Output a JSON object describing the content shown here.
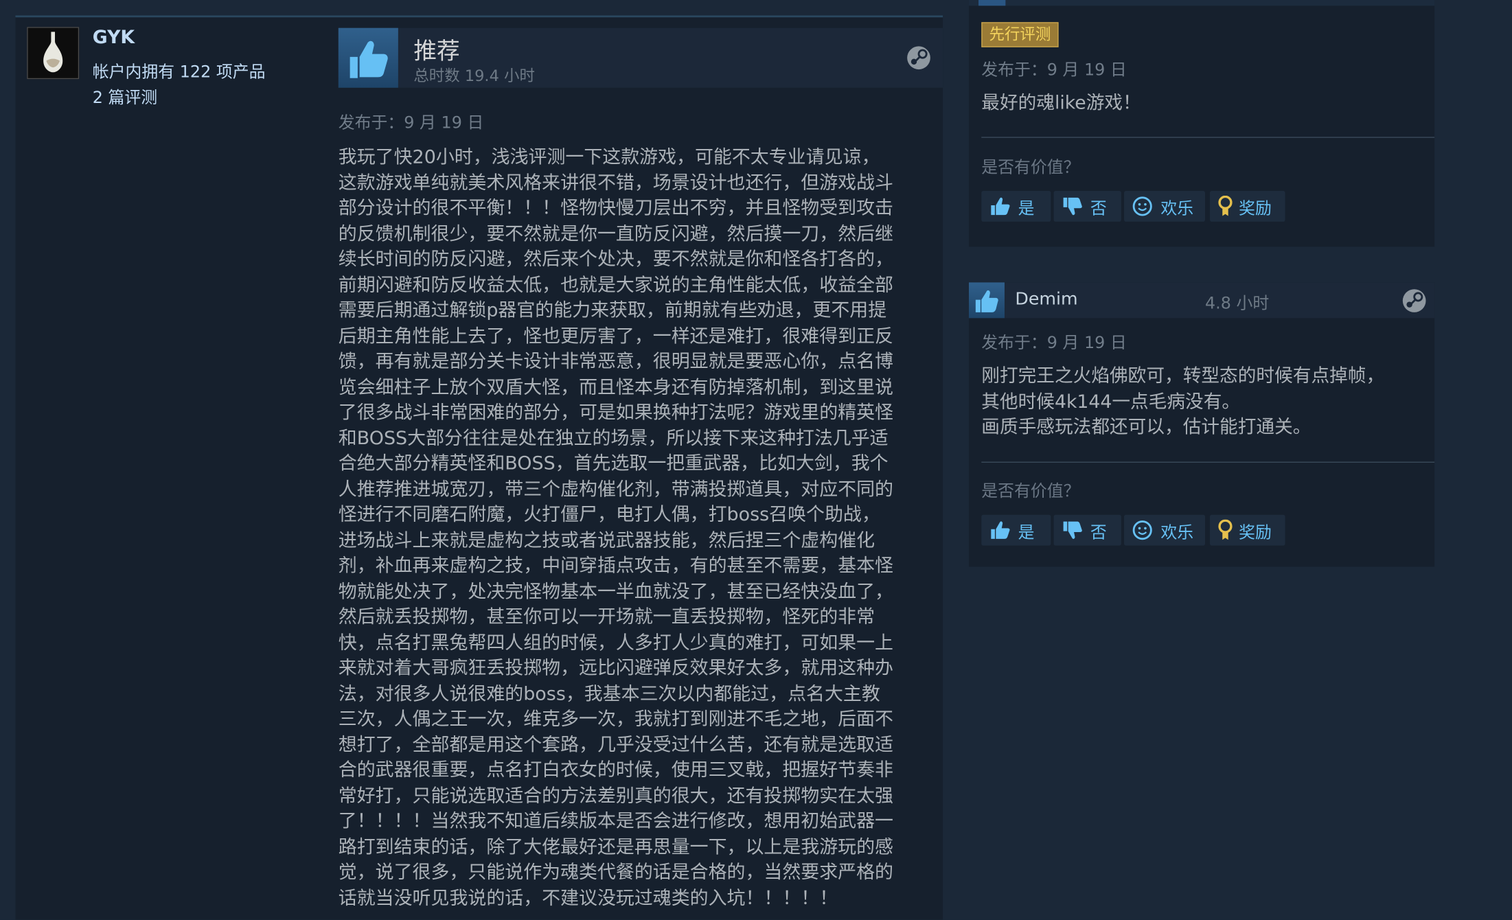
{
  "author": {
    "name": "GYK",
    "products": "帐户内拥有 122 项产品",
    "reviews": "2 篇评测"
  },
  "main_review": {
    "verdict": "推荐",
    "hours": "总时数 19.4 小时",
    "posted": "发布于：9 月 19 日",
    "lines": [
      "我玩了快20小时，浅浅评测一下这款游戏，可能不太专业请见谅，",
      "这款游戏单纯就美术风格来讲很不错，场景设计也还行，但游戏战斗",
      "部分设计的很不平衡！！！怪物快慢刀层出不穷，并且怪物受到攻击",
      "的反馈机制很少，要不然就是你一直防反闪避，然后摸一刀，然后继",
      "续长时间的防反闪避，然后来个处决，要不然就是你和怪各打各的，",
      "前期闪避和防反收益太低，也就是大家说的主角性能太低，收益全部",
      "需要后期通过解锁p器官的能力来获取，前期就有些劝退，更不用提",
      "后期主角性能上去了，怪也更厉害了，一样还是难打，很难得到正反",
      "馈，再有就是部分关卡设计非常恶意，很明显就是要恶心你，点名博",
      "览会细柱子上放个双盾大怪，而且怪本身还有防掉落机制，到这里说",
      "了很多战斗非常困难的部分，可是如果换种打法呢？游戏里的精英怪",
      "和BOSS大部分往往是处在独立的场景，所以接下来这种打法几乎适",
      "合绝大部分精英怪和BOSS，首先选取一把重武器，比如大剑，我个",
      "人推荐推进城宽刃，带三个虚构催化剂，带满投掷道具，对应不同的",
      "怪进行不同磨石附魔，火打僵尸，电打人偶，打boss召唤个助战，",
      "进场战斗上来就是虚构之技或者说武器技能，然后捏三个虚构催化",
      "剂，补血再来虚构之技，中间穿插点攻击，有的甚至不需要，基本怪",
      "物就能处决了，处决完怪物基本一半血就没了，甚至已经快没血了，",
      "然后就丢投掷物，甚至你可以一开场就一直丢投掷物，怪死的非常",
      "快，点名打黑兔帮四人组的时候，人多打人少真的难打，可如果一上",
      "来就对着大哥疯狂丢投掷物，远比闪避弹反效果好太多，就用这种办",
      "法，对很多人说很难的boss，我基本三次以内都能过，点名大主教",
      "三次，人偶之王一次，维克多一次，我就打到刚进不毛之地，后面不",
      "想打了，全部都是用这个套路，几乎没受过什么苦，还有就是选取适",
      "合的武器很重要，点名打白衣女的时候，使用三叉戟，把握好节奏非",
      "常好打，只能说选取适合的方法差别真的很大，还有投掷物实在太强",
      "了！！！！当然我不知道后续版本是否会进行修改，想用初始武器一",
      "路打到结束的话，除了大佬最好还是再思量一下，以上是我游玩的感",
      "觉，说了很多，只能说作为魂类代餐的话是合格的，当然要求严格的",
      "话就当没听见我说的话，不建议没玩过魂类的入坑！！！！！"
    ]
  },
  "side_review_1": {
    "badge": "先行评测",
    "posted": "发布于：9 月 19 日",
    "lines": [
      "最好的魂like游戏！"
    ],
    "helpful_label": "是否有价值？",
    "btn_yes": "是",
    "btn_no": "否",
    "btn_funny": "欢乐",
    "btn_award": "奖励"
  },
  "side_review_2": {
    "author": "Demim",
    "hours": "4.8 小时",
    "posted": "发布于：9 月 19 日",
    "lines": [
      "刚打完王之火焰佛欧可，转型态的时候有点掉帧，",
      "其他时候4k144一点毛病没有。",
      "画质手感玩法都还可以，估计能打通关。"
    ],
    "helpful_label": "是否有价值？",
    "btn_yes": "是",
    "btn_no": "否",
    "btn_funny": "欢乐",
    "btn_award": "奖励"
  },
  "colors": {
    "page_bg": "#1b2838",
    "card_bg": "#16202d",
    "link_blue": "#67c1f5",
    "badge_gold": "#9a7b36"
  },
  "icons": [
    "thumbs-up-icon",
    "steam-logo-icon",
    "thumbs-down-icon",
    "smiley-icon",
    "award-icon"
  ]
}
